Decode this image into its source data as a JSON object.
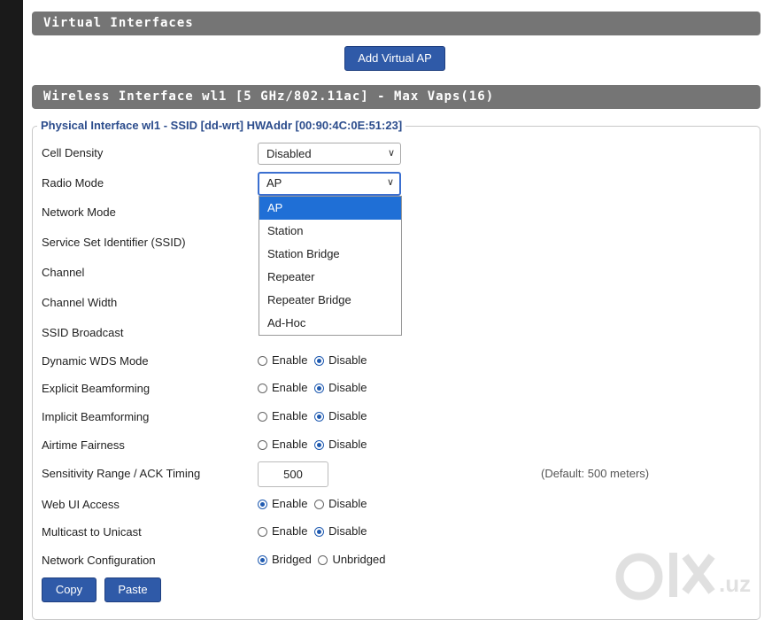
{
  "virtual_interfaces": {
    "title": "Virtual Interfaces",
    "add_button": "Add Virtual AP"
  },
  "wireless_interface": {
    "title": "Wireless Interface wl1 [5 GHz/802.11ac] - Max Vaps(16)",
    "legend": "Physical Interface wl1 - SSID [dd-wrt] HWAddr [00:90:4C:0E:51:23]"
  },
  "fields": {
    "cell_density": {
      "label": "Cell Density",
      "value": "Disabled"
    },
    "radio_mode": {
      "label": "Radio Mode",
      "value": "AP",
      "options": [
        "AP",
        "Station",
        "Station Bridge",
        "Repeater",
        "Repeater Bridge",
        "Ad-Hoc"
      ]
    },
    "network_mode": {
      "label": "Network Mode"
    },
    "ssid": {
      "label": "Service Set Identifier (SSID)"
    },
    "channel": {
      "label": "Channel"
    },
    "channel_width": {
      "label": "Channel Width"
    },
    "ssid_broadcast": {
      "label": "SSID Broadcast"
    },
    "dynamic_wds": {
      "label": "Dynamic WDS Mode",
      "opt1": "Enable",
      "opt2": "Disable",
      "selected": "Disable"
    },
    "explicit_bf": {
      "label": "Explicit Beamforming",
      "opt1": "Enable",
      "opt2": "Disable",
      "selected": "Disable"
    },
    "implicit_bf": {
      "label": "Implicit Beamforming",
      "opt1": "Enable",
      "opt2": "Disable",
      "selected": "Disable"
    },
    "airtime": {
      "label": "Airtime Fairness",
      "opt1": "Enable",
      "opt2": "Disable",
      "selected": "Disable"
    },
    "sensitivity": {
      "label": "Sensitivity Range / ACK Timing",
      "value": "500",
      "hint": "(Default: 500 meters)"
    },
    "web_ui": {
      "label": "Web UI Access",
      "opt1": "Enable",
      "opt2": "Disable",
      "selected": "Enable"
    },
    "multicast": {
      "label": "Multicast to Unicast",
      "opt1": "Enable",
      "opt2": "Disable",
      "selected": "Disable"
    },
    "net_config": {
      "label": "Network Configuration",
      "opt1": "Bridged",
      "opt2": "Unbridged",
      "selected": "Bridged"
    }
  },
  "buttons": {
    "copy": "Copy",
    "paste": "Paste"
  },
  "watermark": {
    "text": "olx.uz"
  }
}
